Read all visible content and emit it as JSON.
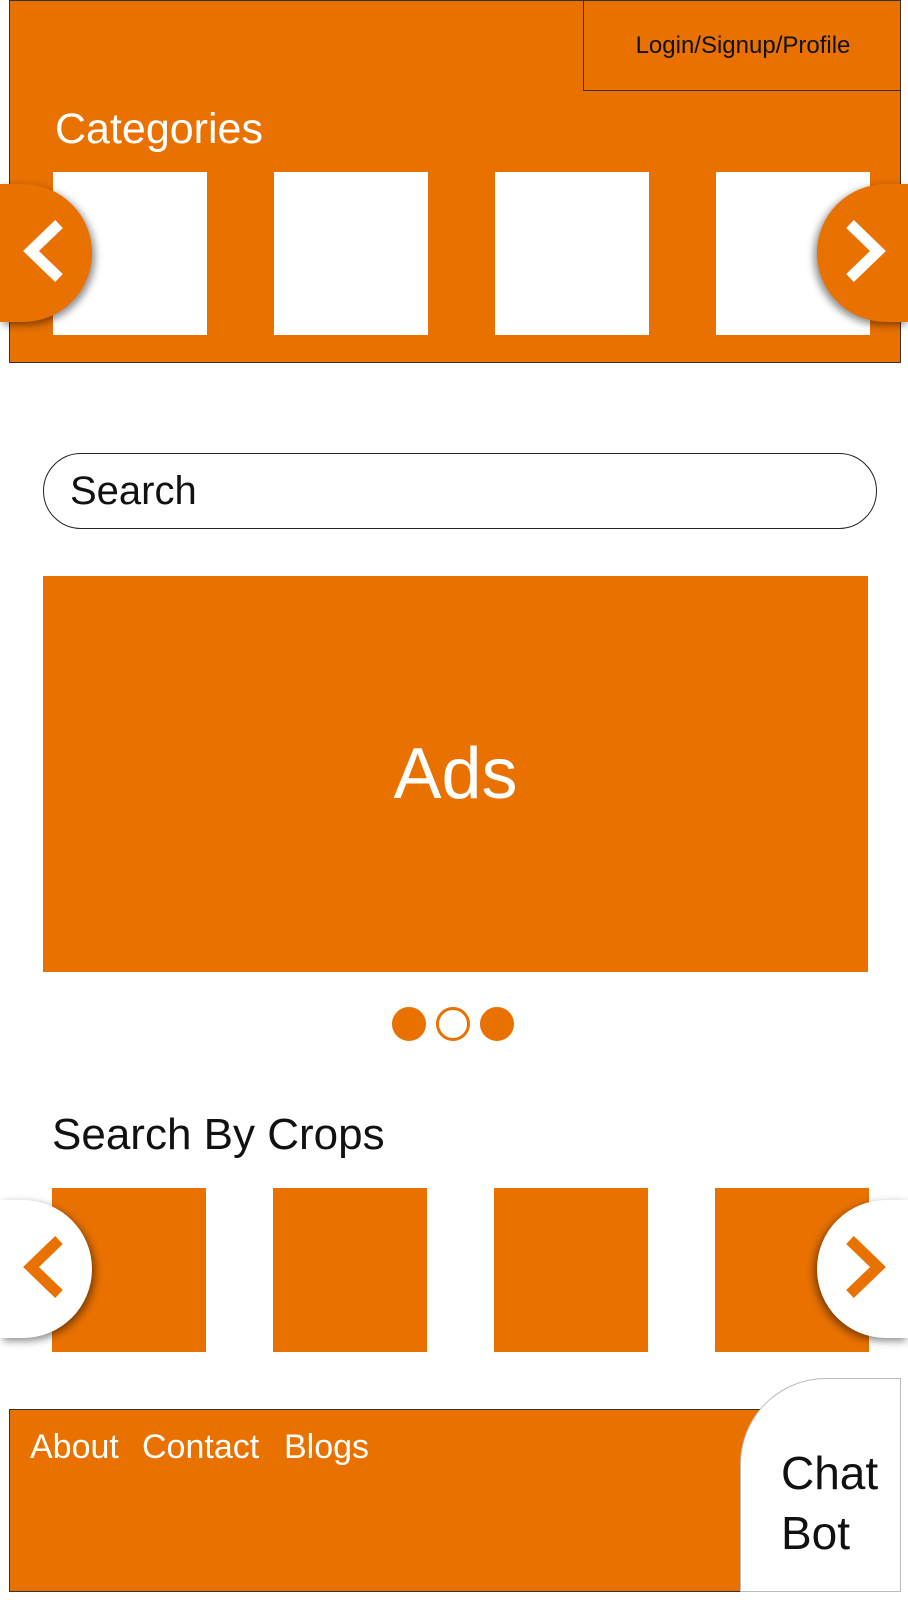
{
  "header": {
    "login_label": "Login/Signup/Profile",
    "categories_title": "Categories"
  },
  "search": {
    "placeholder": "Search"
  },
  "ads": {
    "label": "Ads",
    "carousel_dots": 3,
    "active_dot": 2
  },
  "crops": {
    "title": "Search By Crops"
  },
  "footer": {
    "links": [
      "About",
      "Contact",
      "Blogs"
    ]
  },
  "chatbot": {
    "line1": "Chat",
    "line2": "Bot"
  },
  "colors": {
    "accent": "#E87100",
    "background": "#FFFFFF"
  },
  "icons": {
    "prev": "chevron-left-icon",
    "next": "chevron-right-icon"
  }
}
